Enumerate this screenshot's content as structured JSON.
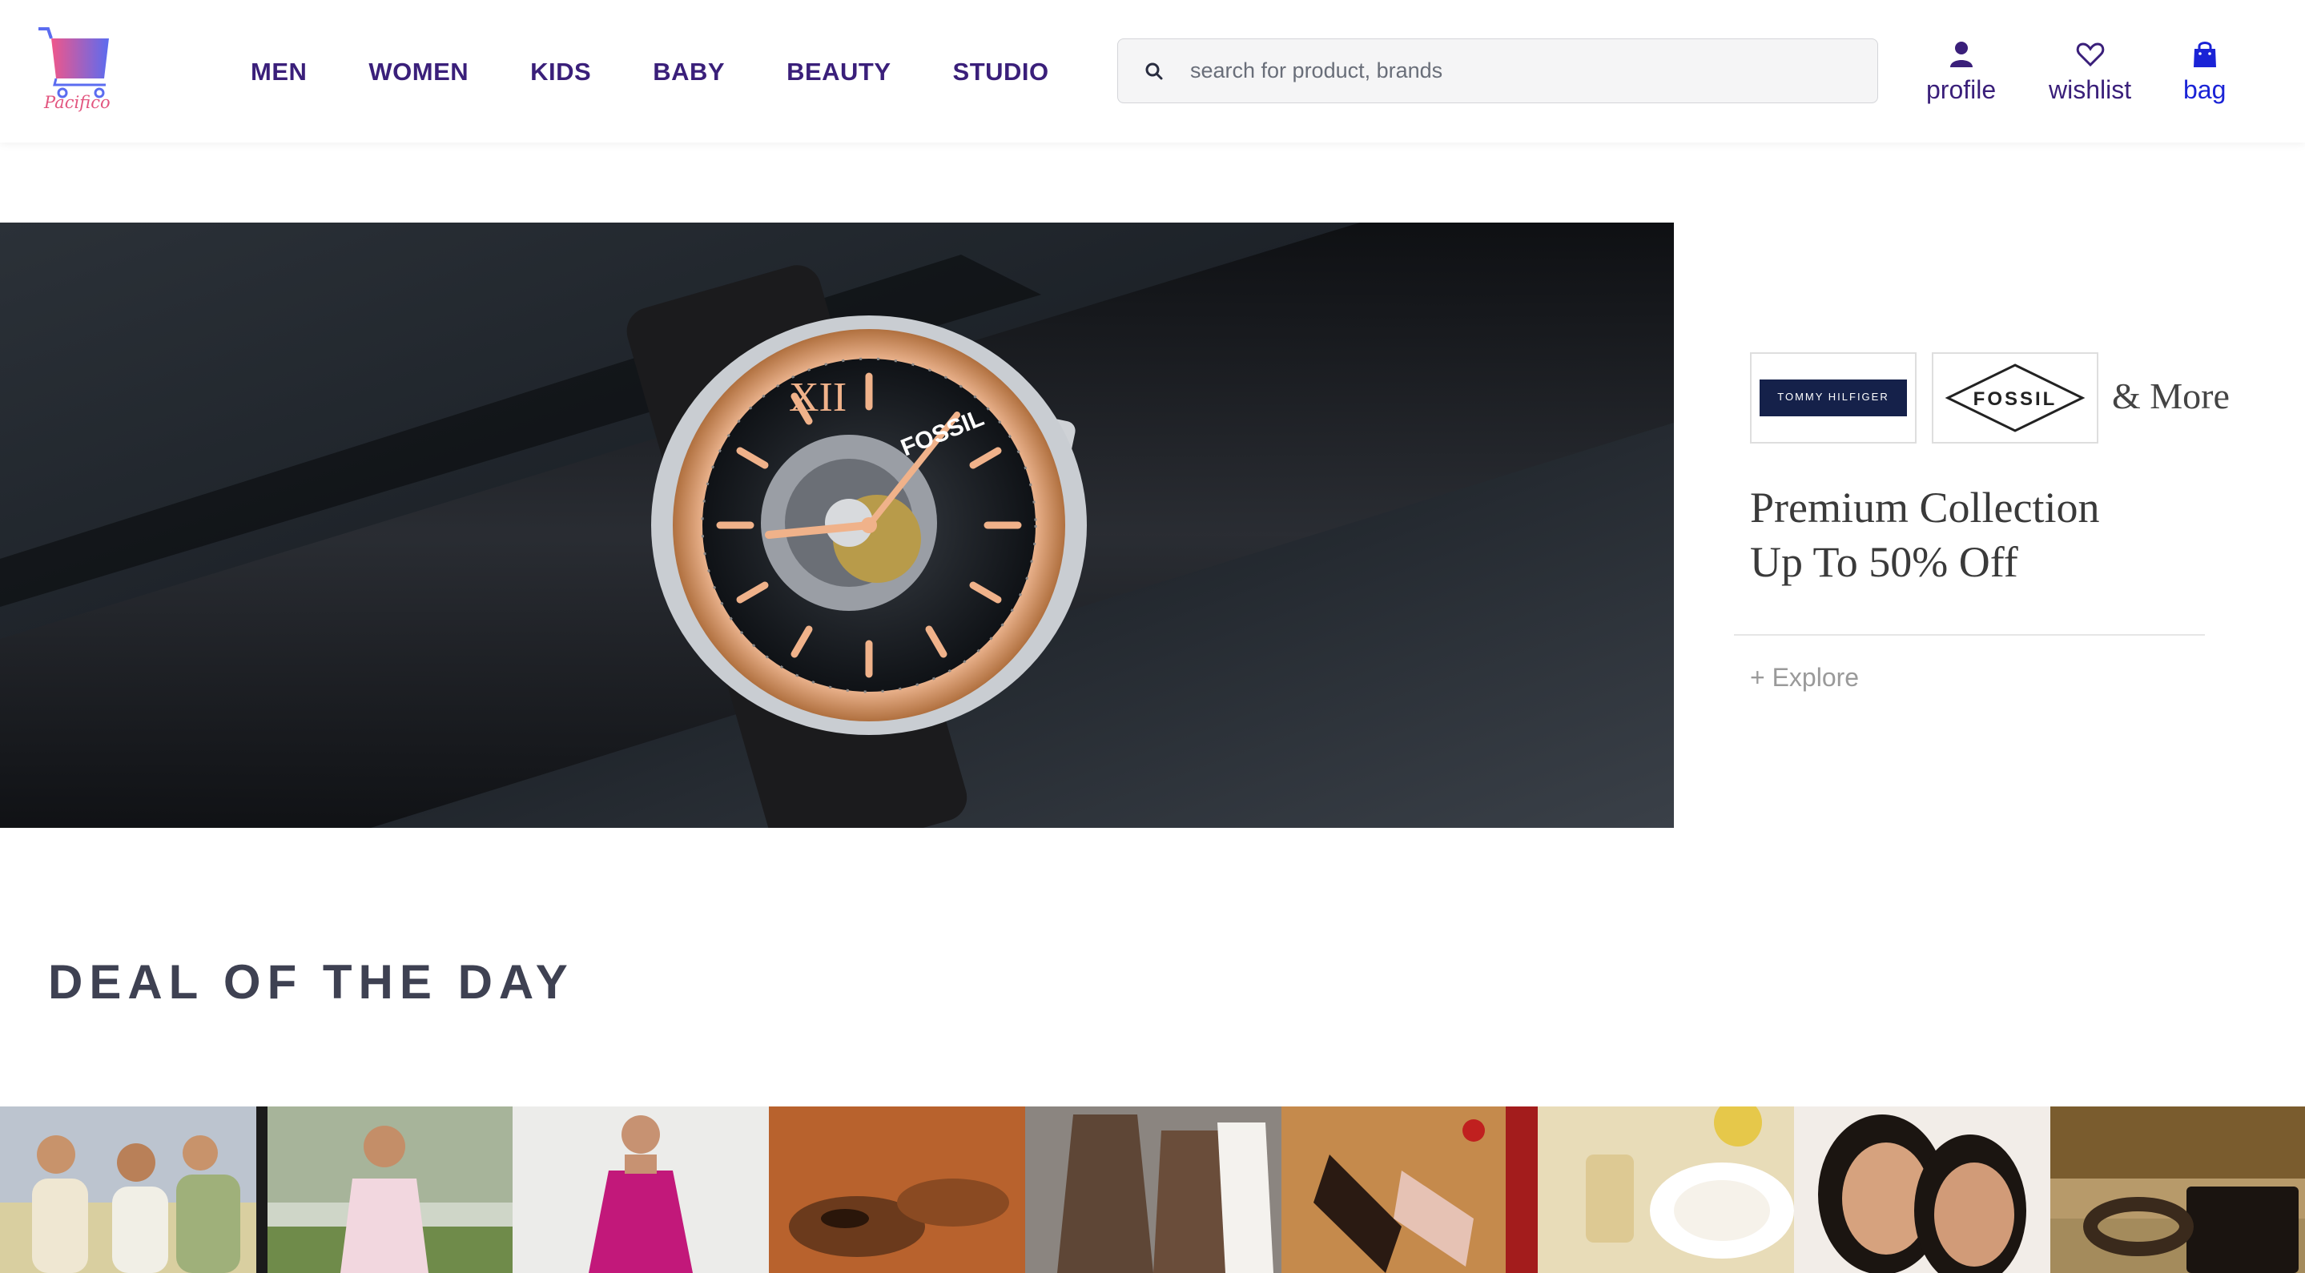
{
  "brand": {
    "logo_text": "Pacifico"
  },
  "nav": {
    "items": [
      {
        "label": "MEN"
      },
      {
        "label": "WOMEN"
      },
      {
        "label": "KIDS"
      },
      {
        "label": "BABY"
      },
      {
        "label": "BEAUTY"
      },
      {
        "label": "STUDIO"
      }
    ]
  },
  "search": {
    "placeholder": "search for product, brands",
    "value": ""
  },
  "actions": {
    "profile": {
      "label": "profile",
      "icon": "user-icon"
    },
    "wishlist": {
      "label": "wishlist",
      "icon": "heart-icon"
    },
    "bag": {
      "label": "bag",
      "icon": "bag-icon"
    }
  },
  "hero": {
    "image": "fossil-watch-banner",
    "watch_brand_text": "FOSSIL"
  },
  "promo": {
    "brands": [
      "TOMMY HILFIGER",
      "FOSSIL"
    ],
    "more": "& More",
    "title_line1": "Premium Collection",
    "title_line2": "Up To 50% Off",
    "explore": "+ Explore"
  },
  "deal": {
    "title": "DEAL OF THE DAY",
    "tiles": [
      {
        "name": "family-fashion"
      },
      {
        "name": "women-ethnic"
      },
      {
        "name": "pink-dress"
      },
      {
        "name": "formal-shoes"
      },
      {
        "name": "casual-shoes"
      },
      {
        "name": "heels"
      },
      {
        "name": "dinnerware"
      },
      {
        "name": "beauty-models"
      },
      {
        "name": "wallets-belts"
      }
    ]
  },
  "colors": {
    "nav_text": "#3a1f7a",
    "bag_text": "#1a23d6",
    "deal_title": "#3e4152",
    "logo_pink": "#e2557f"
  }
}
